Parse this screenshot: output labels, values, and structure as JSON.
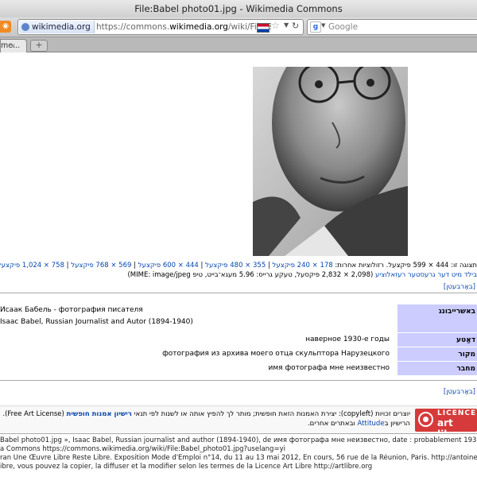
{
  "window": {
    "title": "File:Babel photo01.jpg - Wikimedia Commons"
  },
  "nav": {
    "site_badge": "wikimedia.org",
    "url_prefix": "https://commons.",
    "url_domain": "wikimedia.org",
    "url_path": "/wiki/File:Babel_photo",
    "search_placeholder": "Google"
  },
  "tab": {
    "label": "me..."
  },
  "photo": {
    "alt": "Portrait photograph of Isaac Babel"
  },
  "resolutions": {
    "lead": "תצוגה זו: 444 × 599 פיקצעל. רזולוציות אחרות: ",
    "options": [
      "178 × 240 פיקצעל",
      "355 × 480 פיקצעל",
      "444 × 600 פיקצעל",
      "569 × 768 פיקצעל",
      "758 × 1,024 פיקצעל"
    ]
  },
  "original": {
    "link": "בילד מיט דער גרעסטער רעזאלוציע",
    "text": "(2,098 × 2,832 פיקסעל, טעקע גרייס: 5.96 מעגא־בייט, טיפ MIME: image/jpeg)"
  },
  "edit_link": "[באַרבעטן]",
  "info": {
    "desc_label": "באשרייבונג",
    "desc_lines": [
      "Исаак Бабель - фотография писателя",
      "Isaac Babel, Russian Journalist and Autor (1894-1940)"
    ],
    "date_label": "דאַטע",
    "date_value": "наверное 1930-е годы",
    "source_label": "מקור",
    "source_value": "фотография из архива моего отца скульптора Нарузецкого",
    "author_label": "מחבר",
    "author_value": "имя фотографа мне неизвестно"
  },
  "license": {
    "badge_top": "LICENCE",
    "badge_bottom": "art libre",
    "line1_a": "יוצרים זכויות (copyleft): יצירת האמנות הזאת חופשית; מותר לך להפיץ אותה או לשנות לפי תנאי ",
    "line1_link": "רישיון אמנות חופשית",
    "line1_b": " (Free Art License). אפשר למצוא עותק של",
    "line2_a": "הרישיון ב",
    "line2_link": "Attitude",
    "line2_b": " ובאתרים אחרים."
  },
  "footer": [
    "Babel photo01.jpg », Isaac Babel, Russian journalist and author (1894-1940), de имя фотографа мне неизвестно, date : probablement 1930, copyleft Licence Art Libre",
    "a Commons https://commons.wikimedia.org/wiki/File:Babel_photo01.jpg?uselang=yi",
    "ran Une Œuvre Libre Reste Libre. Exposition Mode d'Emploi n°14, du 11 au 13 mai 2012, En cours, 56 rue de la Réunion, Paris. http://antoinemoreau.org/index.php?ca",
    "ibre, vous pouvez la copier, la diffuser et la modifier selon les termes de la Licence Art Libre http://artlibre.org"
  ]
}
